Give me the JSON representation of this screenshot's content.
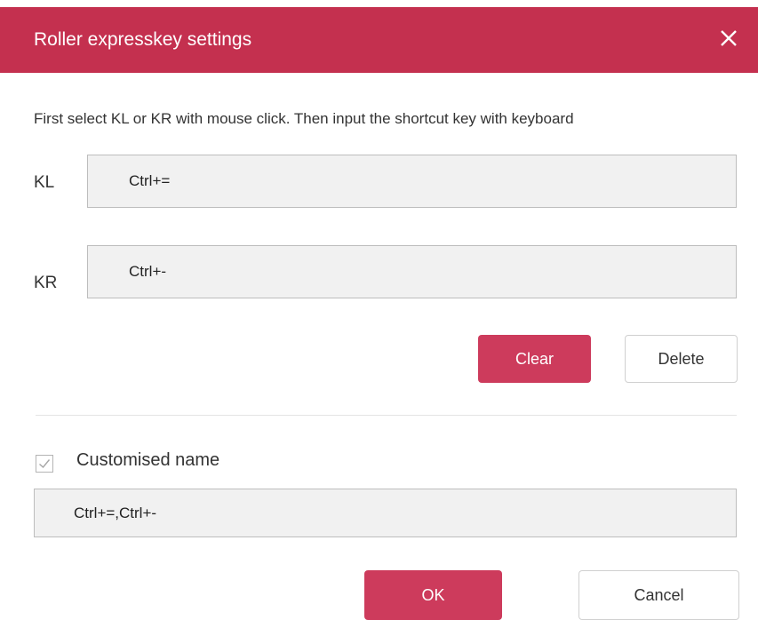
{
  "dialog": {
    "title": "Roller expresskey settings"
  },
  "instruction": "First select KL or KR with mouse click. Then input the shortcut key with keyboard",
  "keys": {
    "kl": {
      "label": "KL",
      "value": "Ctrl+="
    },
    "kr": {
      "label": "KR",
      "value": "Ctrl+-"
    }
  },
  "actions": {
    "clear_label": "Clear",
    "delete_label": "Delete"
  },
  "custom_name": {
    "checkbox_label": "Customised name",
    "checked": true,
    "value": "Ctrl+=,Ctrl+-"
  },
  "footer": {
    "ok_label": "OK",
    "cancel_label": "Cancel"
  },
  "colors": {
    "accent": "#c4304f",
    "button_primary": "#cd3b5c",
    "field_bg": "#f1f1f1"
  },
  "icons": {
    "close": "close-icon",
    "check": "checkmark-icon"
  }
}
